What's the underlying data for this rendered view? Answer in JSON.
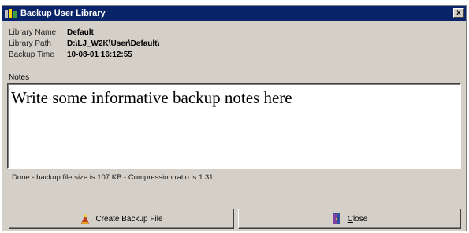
{
  "window": {
    "title": "Backup User Library",
    "close_label": "x",
    "app_icon": "library-icon"
  },
  "info": {
    "library_name_label": "Library Name",
    "library_name": "Default",
    "library_path_label": "Library Path",
    "library_path": "D:\\LJ_W2K\\User\\Default\\",
    "backup_time_label": "Backup Time",
    "backup_time": "10-08-01 16:12:55"
  },
  "notes": {
    "label": "Notes",
    "value": "Write some informative backup notes here"
  },
  "status": {
    "text": "Done - backup file size is 107 KB - Compression ratio is 1:31"
  },
  "buttons": {
    "create_label": "Create Backup File",
    "create_icon": "backup-icon",
    "close_label_first": "C",
    "close_label_rest": "lose",
    "close_icon": "door-exit-icon"
  }
}
